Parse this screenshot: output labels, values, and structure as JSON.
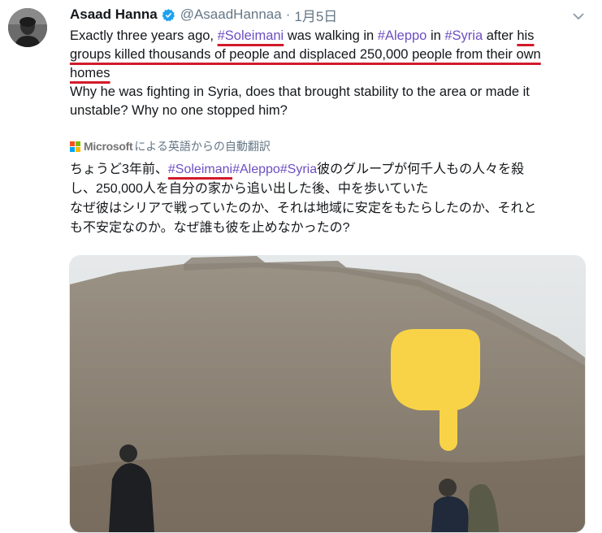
{
  "author": {
    "name": "Asaad Hanna",
    "handle": "@AsaadHannaa",
    "separator": "·",
    "date": "1月5日"
  },
  "tweet": {
    "line1": {
      "a": "Exactly three years ago, ",
      "tag": "#Soleimani",
      "b": " was walking in ",
      "tag2": "#Aleppo",
      "c": " in ",
      "tag3": "#Syria",
      "d": " after ",
      "e": "his"
    },
    "line2": "groups killed thousands of people and displaced 250,000 people from their own",
    "line3": "homes",
    "line4": "Why he was fighting in Syria, does that brought stability to the area or made it",
    "line5": "unstable? Why no one stopped him?"
  },
  "translation": {
    "provider": "Microsoft",
    "label": "による英語からの自動翻訳",
    "line1": {
      "a": "ちょうど3年前、",
      "tag": "#Soleimani",
      "tag2": "#Aleppo",
      "tag3": "#Syria",
      "b": "彼のグループが何千人もの人々を殺"
    },
    "line2": "し、250,000人を自分の家から追い出した後、中を歩いていた",
    "line3": "なぜ彼はシリアで戦っていたのか、それは地域に安定をもたらしたのか、それと",
    "line4": "も不安定なのか。なぜ誰も彼を止めなかったの?"
  },
  "colors": {
    "hashtag": "#6d4fc2",
    "underline": "#d11a2a",
    "pointer": "#f8d347"
  },
  "icons": [
    "verified-badge-icon",
    "caret-down-icon",
    "microsoft-logo-icon",
    "pointing-hand-icon"
  ]
}
